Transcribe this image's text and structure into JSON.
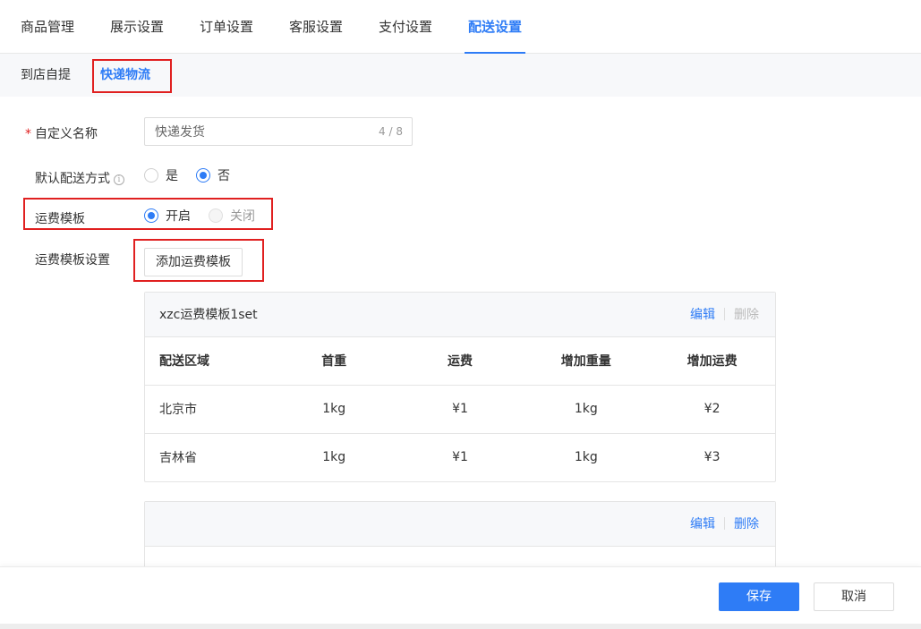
{
  "top_tabs": [
    {
      "label": "商品管理",
      "active": false
    },
    {
      "label": "展示设置",
      "active": false
    },
    {
      "label": "订单设置",
      "active": false
    },
    {
      "label": "客服设置",
      "active": false
    },
    {
      "label": "支付设置",
      "active": false
    },
    {
      "label": "配送设置",
      "active": true
    }
  ],
  "sub_tabs": [
    {
      "label": "到店自提",
      "active": false
    },
    {
      "label": "快递物流",
      "active": true
    }
  ],
  "form": {
    "custom_name": {
      "required_mark": "*",
      "label": "自定义名称",
      "value": "快递发货",
      "count": "4 / 8"
    },
    "default_delivery": {
      "label": "默认配送方式",
      "info_icon": "i",
      "options": [
        "是",
        "否"
      ],
      "selected": "否"
    },
    "fee_template": {
      "label": "运费模板",
      "options": [
        "开启",
        "关闭"
      ],
      "selected": "开启"
    },
    "fee_template_settings": {
      "label": "运费模板设置",
      "add_button": "添加运费模板"
    }
  },
  "templates": [
    {
      "title": "xzc运费模板1set",
      "edit_label": "编辑",
      "delete_label": "删除",
      "delete_disabled": true,
      "columns": [
        "配送区域",
        "首重",
        "运费",
        "增加重量",
        "增加运费"
      ],
      "rows": [
        [
          "北京市",
          "1kg",
          "¥1",
          "1kg",
          "¥2"
        ],
        [
          "吉林省",
          "1kg",
          "¥1",
          "1kg",
          "¥3"
        ]
      ]
    },
    {
      "title": "",
      "edit_label": "编辑",
      "delete_label": "删除",
      "delete_disabled": false
    }
  ],
  "footer": {
    "save_label": "保存",
    "cancel_label": "取消"
  },
  "colors": {
    "accent": "#2e7cf6",
    "highlight_border": "#e02020"
  }
}
